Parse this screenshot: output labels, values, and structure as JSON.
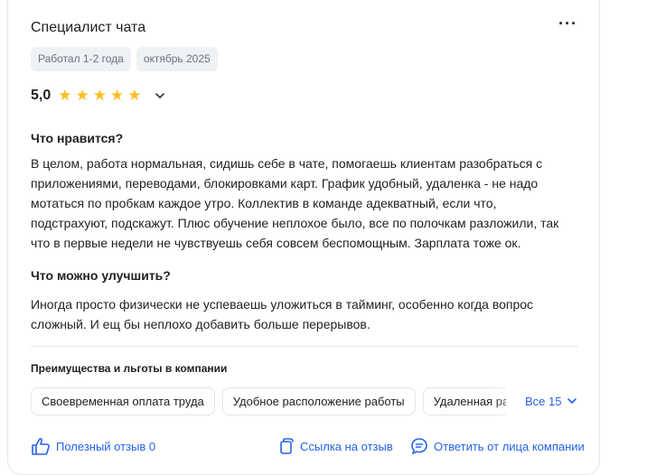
{
  "review": {
    "title": "Специалист чата",
    "more_label": "···",
    "tags": [
      "Работал 1-2 года",
      "октябрь 2025"
    ],
    "rating": "5,0",
    "stars": 5,
    "likes_heading": "Что нравится?",
    "likes_text": "В целом, работа нормальная, сидишь себе в чате, помогаешь клиентам разобраться с приложениями, переводами, блокировками карт. График удобный, удаленка - не надо мотаться по пробкам каждое утро. Коллектив в команде адекватный, если что, подстрахуют, подскажут. Плюс обучение неплохое было, все по полочкам разложили, так что в первые недели не чувствуешь себя совсем беспомощным. Зарплата тоже ок.",
    "improve_heading": "Что можно улучшить?",
    "improve_text": "Иногда просто физически не успеваешь уложиться в тайминг, особенно когда вопрос сложный. И ещ бы неплохо добавить больше перерывов.",
    "benefits_heading": "Преимущества и льготы в компании",
    "benefits": [
      "Своевременная оплата труда",
      "Удобное расположение работы",
      "Удаленная работа"
    ],
    "all_label": "Все 15"
  },
  "footer": {
    "helpful": "Полезный отзыв 0",
    "link": "Ссылка на отзыв",
    "reply": "Ответить от лица компании"
  },
  "colors": {
    "accent": "#2563eb",
    "star": "#fbbf24",
    "tag_bg": "#eef1f5"
  }
}
